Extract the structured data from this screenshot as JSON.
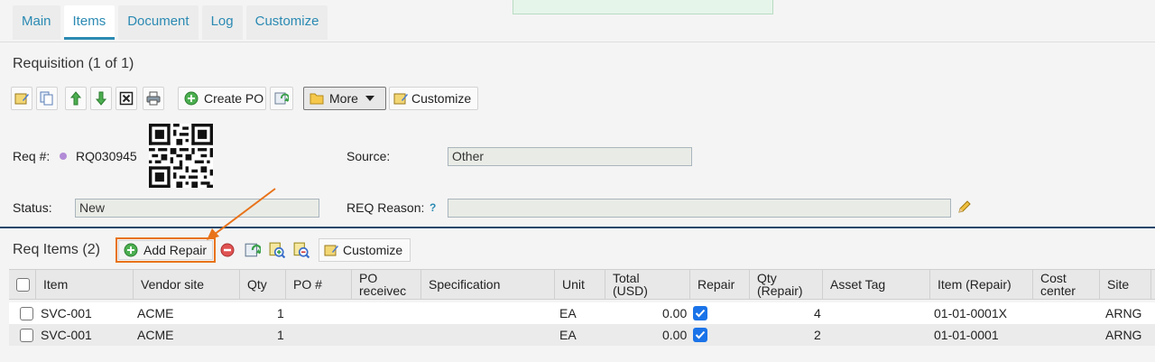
{
  "tabs": [
    {
      "label": "Main"
    },
    {
      "label": "Items"
    },
    {
      "label": "Document"
    },
    {
      "label": "Log"
    },
    {
      "label": "Customize"
    }
  ],
  "requisition": {
    "title": "Requisition (1 of 1)",
    "toolbar": {
      "create_po_label": "Create PO",
      "more_label": "More",
      "customize_label": "Customize"
    },
    "req_label": "Req #:",
    "req_number": "RQ030945",
    "source_label": "Source:",
    "source_value": "Other",
    "status_label": "Status:",
    "status_value": "New",
    "reason_label": "REQ Reason:",
    "reason_help": "?",
    "reason_value": ""
  },
  "req_items": {
    "title": "Req Items (2)",
    "add_repair_label": "Add Repair",
    "customize_label": "Customize",
    "columns": [
      "Item",
      "Vendor site",
      "Qty",
      "PO #",
      "PO receivec",
      "Specification",
      "Unit",
      "Total (USD)",
      "Repair",
      "Qty (Repair)",
      "Asset Tag",
      "Item (Repair)",
      "Cost center",
      "Site"
    ],
    "rows": [
      {
        "item": "SVC-001",
        "vendor": "ACME",
        "qty": "1",
        "unit": "EA",
        "total": "0.00",
        "repair": true,
        "qty_repair": "4",
        "item_repair": "01-01-0001X",
        "site": "ARNG"
      },
      {
        "item": "SVC-001",
        "vendor": "ACME",
        "qty": "1",
        "unit": "EA",
        "total": "0.00",
        "repair": true,
        "qty_repair": "2",
        "item_repair": "01-01-0001",
        "site": "ARNG"
      }
    ]
  },
  "colors": {
    "accent": "#2b8ab3",
    "highlight": "#e8731a",
    "checkbox": "#1a73e8",
    "divider": "#24476a"
  }
}
